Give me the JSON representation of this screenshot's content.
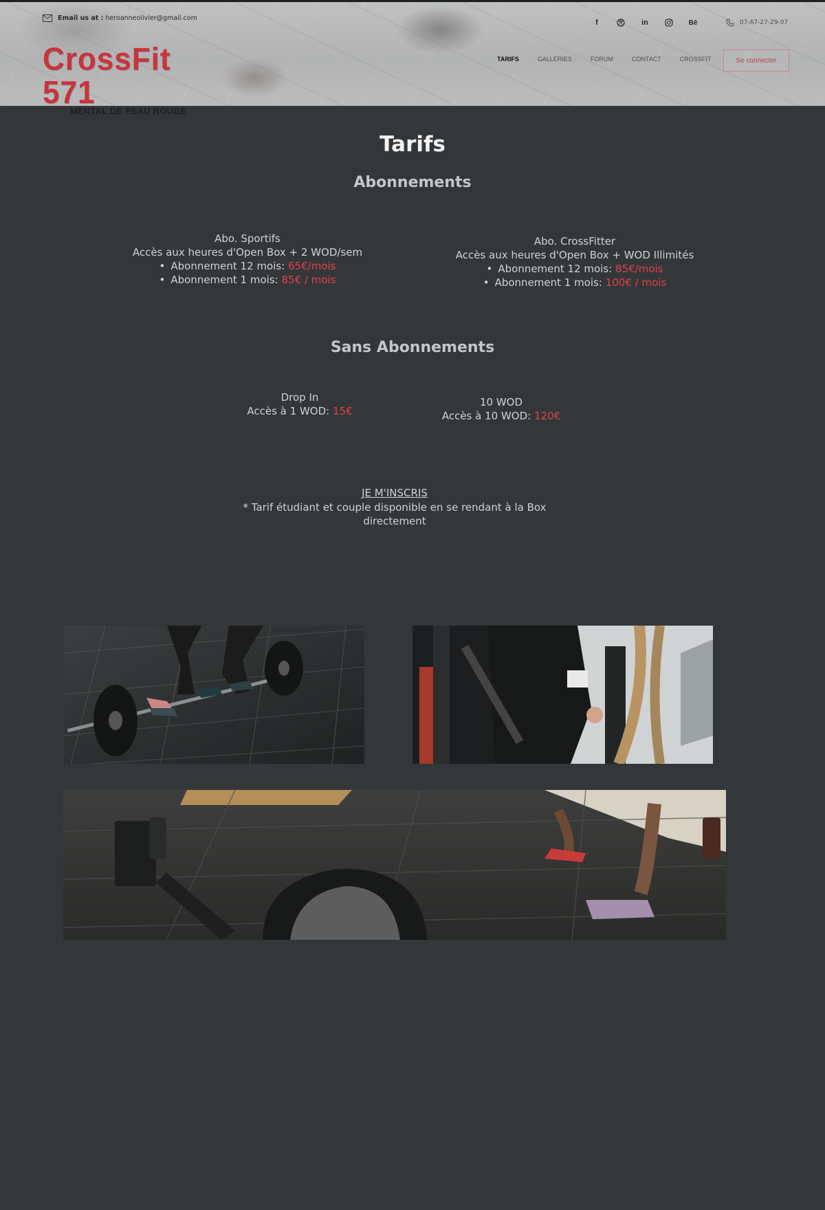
{
  "header": {
    "email_label": "Email us at :",
    "email": "heroanneolivier@gmail.com",
    "phone": "07-67-27-29-07",
    "logo": {
      "main": "CrossFit 571",
      "sub": "MENTAL DE PEAU ROUGE"
    },
    "social": [
      "facebook-icon",
      "dribbble-icon",
      "linkedin-icon",
      "instagram-icon",
      "behance-icon"
    ],
    "nav": [
      "TARIFS",
      "GALLERIES",
      "FORUM",
      "CONTACT",
      "CROSSFIT"
    ],
    "active_nav": "TARIFS",
    "login_label": "Se connecter"
  },
  "page": {
    "title": "Tarifs",
    "abonnements": {
      "heading": "Abonnements",
      "plans": [
        {
          "name": "Abo. Sportifs",
          "desc": "Accès aux heures d'Open Box + 2 WOD/sem",
          "rows": [
            {
              "label": "Abonnement 12 mois:",
              "price": "65€/mois"
            },
            {
              "label": "Abonnement 1 mois:",
              "price": "85€ / mois"
            }
          ]
        },
        {
          "name": "Abo. CrossFitter",
          "desc": "Accès aux heures d'Open Box + WOD Illimités",
          "rows": [
            {
              "label": "Abonnement 12 mois:",
              "price": "85€/mois"
            },
            {
              "label": "Abonnement 1 mois:",
              "price": "100€ / mois"
            }
          ]
        }
      ]
    },
    "sans_abonnements": {
      "heading": "Sans Abonnements",
      "plans": [
        {
          "name": "Drop In",
          "label": "Accès à 1 WOD:",
          "price": "15€"
        },
        {
          "name": "10 WOD",
          "label": "Accès à 10 WOD:",
          "price": "120€"
        }
      ]
    },
    "signup_link": "JE M'INSCRIS",
    "note": "* Tarif étudiant et couple disponible en se rendant à la Box directement"
  },
  "colors": {
    "background": "#34373a",
    "accent": "#e0424c",
    "logo_red": "#c9343c"
  }
}
